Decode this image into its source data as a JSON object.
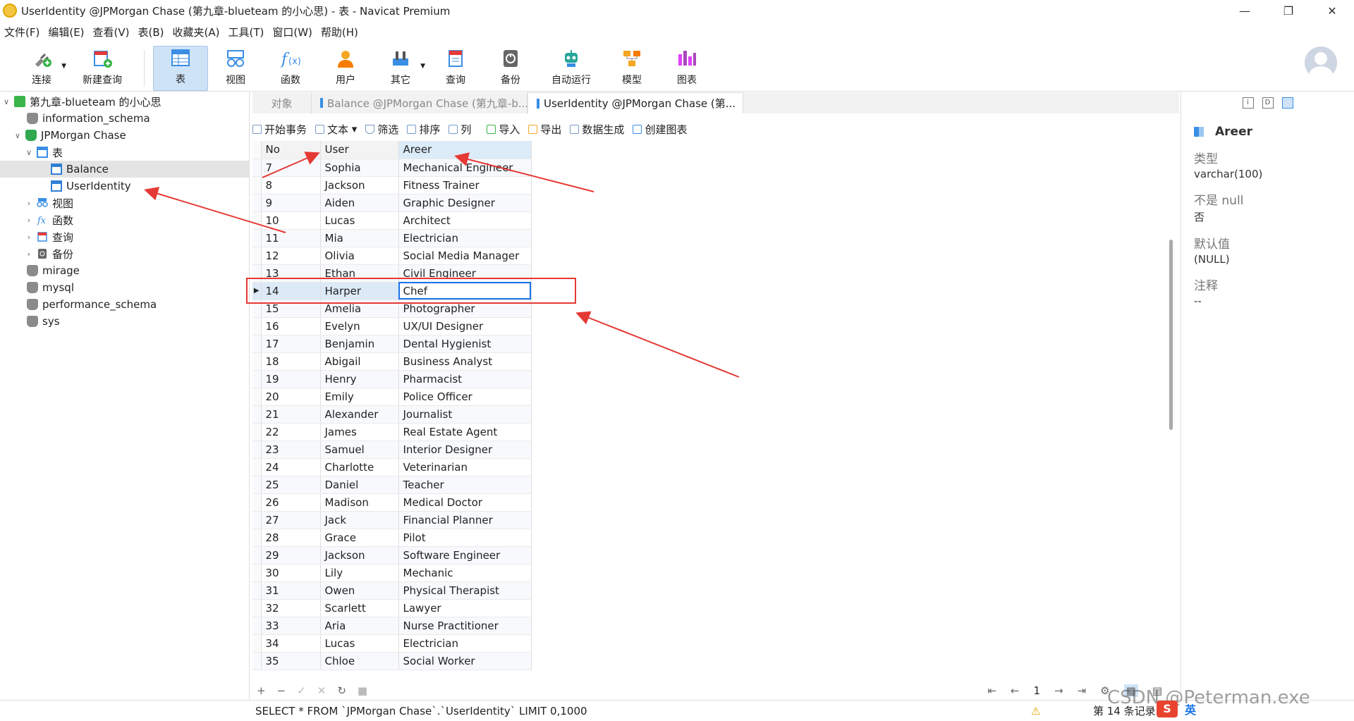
{
  "window": {
    "title": "UserIdentity @JPMorgan Chase (第九章-blueteam 的小心思) - 表 - Navicat Premium"
  },
  "menu": [
    "文件(F)",
    "编辑(E)",
    "查看(V)",
    "表(B)",
    "收藏夹(A)",
    "工具(T)",
    "窗口(W)",
    "帮助(H)"
  ],
  "toolbar": {
    "connect": "连接",
    "new_query": "新建查询",
    "table": "表",
    "view": "视图",
    "function": "函数",
    "user": "用户",
    "other": "其它",
    "query": "查询",
    "backup": "备份",
    "automation": "自动运行",
    "model": "模型",
    "chart": "图表"
  },
  "tree": {
    "connection": "第九章-blueteam 的小心思",
    "db_info_schema": "information_schema",
    "db_jpm": "JPMorgan Chase",
    "tables_label": "表",
    "table_balance": "Balance",
    "table_useridentity": "UserIdentity",
    "views": "视图",
    "functions": "函数",
    "queries": "查询",
    "backups": "备份",
    "db_mirage": "mirage",
    "db_mysql": "mysql",
    "db_perf": "performance_schema",
    "db_sys": "sys"
  },
  "tabs": {
    "objects": "对象",
    "balance": "Balance @JPMorgan Chase (第九章-b...",
    "useridentity": "UserIdentity @JPMorgan Chase (第..."
  },
  "gridtoolbar": {
    "begin_tx": "开始事务",
    "text": "文本",
    "filter": "筛选",
    "sort": "排序",
    "columns": "列",
    "import": "导入",
    "export": "导出",
    "datagen": "数据生成",
    "createchart": "创建图表"
  },
  "grid": {
    "columns": [
      "No",
      "User",
      "Areer"
    ],
    "current_row_no": "14",
    "rows": [
      [
        "7",
        "Sophia",
        "Mechanical Engineer"
      ],
      [
        "8",
        "Jackson",
        "Fitness Trainer"
      ],
      [
        "9",
        "Aiden",
        "Graphic Designer"
      ],
      [
        "10",
        "Lucas",
        "Architect"
      ],
      [
        "11",
        "Mia",
        "Electrician"
      ],
      [
        "12",
        "Olivia",
        "Social Media Manager"
      ],
      [
        "13",
        "Ethan",
        "Civil Engineer"
      ],
      [
        "14",
        "Harper",
        "Chef"
      ],
      [
        "15",
        "Amelia",
        "Photographer"
      ],
      [
        "16",
        "Evelyn",
        "UX/UI Designer"
      ],
      [
        "17",
        "Benjamin",
        "Dental Hygienist"
      ],
      [
        "18",
        "Abigail",
        "Business Analyst"
      ],
      [
        "19",
        "Henry",
        "Pharmacist"
      ],
      [
        "20",
        "Emily",
        "Police Officer"
      ],
      [
        "21",
        "Alexander",
        "Journalist"
      ],
      [
        "22",
        "James",
        "Real Estate Agent"
      ],
      [
        "23",
        "Samuel",
        "Interior Designer"
      ],
      [
        "24",
        "Charlotte",
        "Veterinarian"
      ],
      [
        "25",
        "Daniel",
        "Teacher"
      ],
      [
        "26",
        "Madison",
        "Medical Doctor"
      ],
      [
        "27",
        "Jack",
        "Financial Planner"
      ],
      [
        "28",
        "Grace",
        "Pilot"
      ],
      [
        "29",
        "Jackson",
        "Software Engineer"
      ],
      [
        "30",
        "Lily",
        "Mechanic"
      ],
      [
        "31",
        "Owen",
        "Physical Therapist"
      ],
      [
        "32",
        "Scarlett",
        "Lawyer"
      ],
      [
        "33",
        "Aria",
        "Nurse Practitioner"
      ],
      [
        "34",
        "Lucas",
        "Electrician"
      ],
      [
        "35",
        "Chloe",
        "Social Worker"
      ]
    ]
  },
  "pager": {
    "page": "1"
  },
  "status": {
    "sql": "SELECT * FROM `JPMorgan Chase`.`UserIdentity` LIMIT 0,1000",
    "records": "第 14 条记录"
  },
  "field_panel": {
    "name": "Areer",
    "type_label": "类型",
    "type_value": "varchar(100)",
    "notnull_label": "不是 null",
    "notnull_value": "否",
    "default_label": "默认值",
    "default_value": "(NULL)",
    "comment_label": "注释",
    "comment_value": "--"
  },
  "watermark": "CSDN @Peterman.exe",
  "ime": {
    "lang": "英"
  },
  "colors": {
    "accent": "#1a73e8",
    "annotation_red": "#e53935",
    "selected_tab_bg": "#cfe3f7"
  }
}
